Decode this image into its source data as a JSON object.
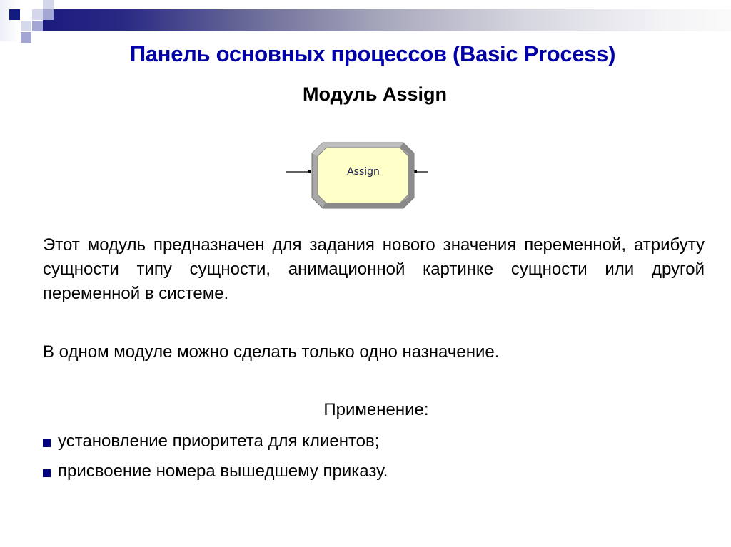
{
  "slide": {
    "title": "Панель основных процессов (Basic Process)",
    "subtitle": "Модуль Assign",
    "module": {
      "label": "Assign",
      "fill_color": "#ffffc8",
      "border_color": "#a0a0a0"
    },
    "paragraphs": [
      "Этот модуль предназначен для задания нового значения переменной, атрибуту сущности типу сущности, анимационной картинке сущности или другой переменной в системе.",
      "В одном модуле можно сделать только одно назначение."
    ],
    "usage_title": "Применение:",
    "usage_items": [
      "установление приоритета для клиентов;",
      "присвоение номера вышедшему приказу."
    ],
    "colors": {
      "title": "#0000a6",
      "bullet": "#000080",
      "header_bar_start": "#1b1b7e"
    }
  }
}
